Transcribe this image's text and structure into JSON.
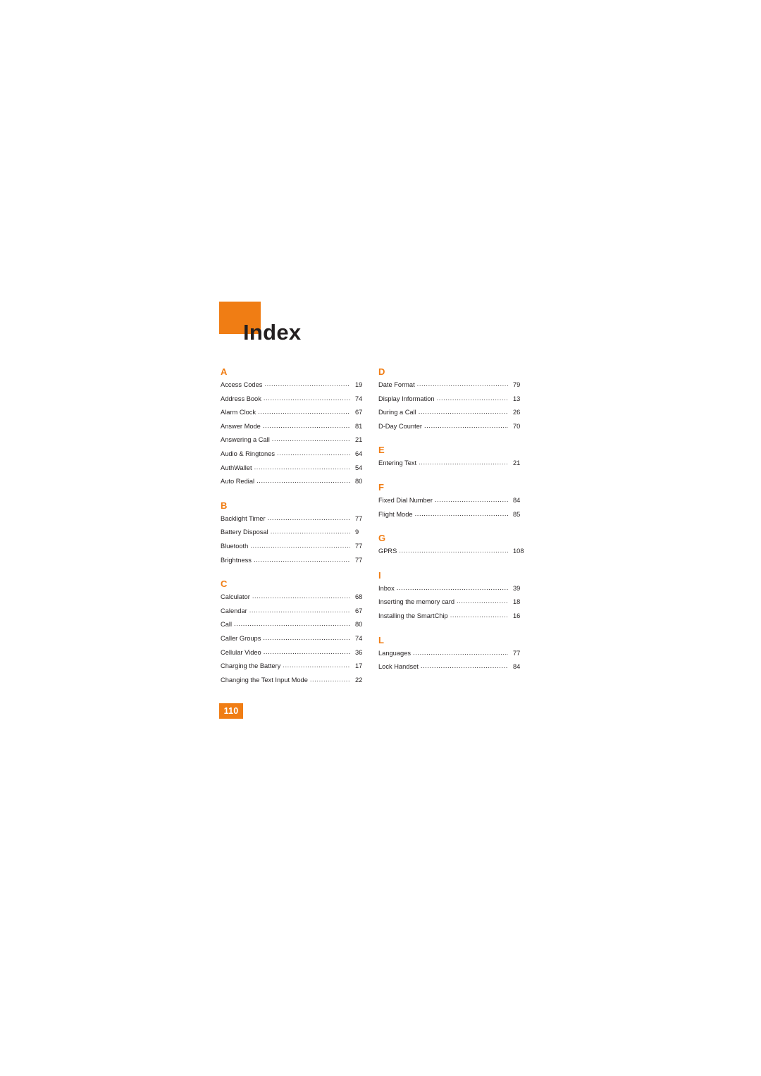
{
  "document": {
    "title": "Index",
    "page_number": "110",
    "accent_color": "#f07d14",
    "text_color": "#231f20"
  },
  "columns": [
    {
      "name": "left-column",
      "sections": [
        {
          "letter": "A",
          "entries": [
            {
              "label": "Access Codes",
              "page": "19"
            },
            {
              "label": "Address Book",
              "page": "74"
            },
            {
              "label": "Alarm Clock",
              "page": "67"
            },
            {
              "label": "Answer Mode",
              "page": "81"
            },
            {
              "label": "Answering a Call",
              "page": "21"
            },
            {
              "label": "Audio & Ringtones",
              "page": "64"
            },
            {
              "label": "AuthWallet",
              "page": "54"
            },
            {
              "label": "Auto Redial",
              "page": "80"
            }
          ]
        },
        {
          "letter": "B",
          "entries": [
            {
              "label": "Backlight Timer",
              "page": "77"
            },
            {
              "label": "Battery Disposal",
              "page": "9"
            },
            {
              "label": "Bluetooth",
              "page": "77"
            },
            {
              "label": "Brightness",
              "page": "77"
            }
          ]
        },
        {
          "letter": "C",
          "entries": [
            {
              "label": "Calculator",
              "page": "68"
            },
            {
              "label": "Calendar",
              "page": "67"
            },
            {
              "label": "Call",
              "page": "80"
            },
            {
              "label": "Caller Groups",
              "page": "74"
            },
            {
              "label": "Cellular Video",
              "page": "36"
            },
            {
              "label": "Charging the Battery",
              "page": "17"
            },
            {
              "label": "Changing the Text Input Mode",
              "page": "22"
            }
          ]
        }
      ]
    },
    {
      "name": "right-column",
      "sections": [
        {
          "letter": "D",
          "entries": [
            {
              "label": "Date Format",
              "page": "79"
            },
            {
              "label": "Display Information",
              "page": "13"
            },
            {
              "label": "During a Call",
              "page": "26"
            },
            {
              "label": "D-Day Counter",
              "page": "70"
            }
          ]
        },
        {
          "letter": "E",
          "entries": [
            {
              "label": "Entering Text",
              "page": "21"
            }
          ]
        },
        {
          "letter": "F",
          "entries": [
            {
              "label": "Fixed Dial Number",
              "page": "84"
            },
            {
              "label": "Flight Mode",
              "page": "85"
            }
          ]
        },
        {
          "letter": "G",
          "entries": [
            {
              "label": "GPRS",
              "page": "108"
            }
          ]
        },
        {
          "letter": "I",
          "entries": [
            {
              "label": "Inbox",
              "page": "39"
            },
            {
              "label": "Inserting the memory card",
              "page": "18"
            },
            {
              "label": "Installing the SmartChip",
              "page": "16"
            }
          ]
        },
        {
          "letter": "L",
          "entries": [
            {
              "label": "Languages",
              "page": "77"
            },
            {
              "label": "Lock Handset",
              "page": "84"
            }
          ]
        }
      ]
    }
  ]
}
